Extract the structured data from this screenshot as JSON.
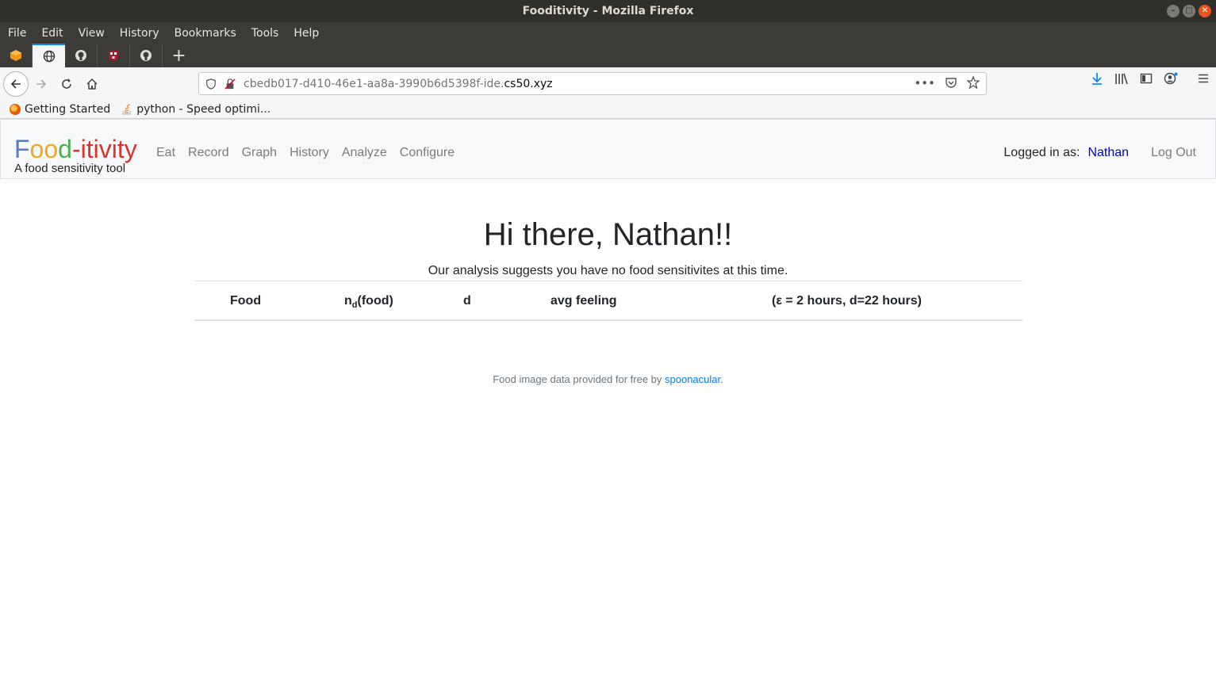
{
  "window": {
    "title": "Fooditivity - Mozilla Firefox"
  },
  "menu": [
    "File",
    "Edit",
    "View",
    "History",
    "Bookmarks",
    "Tools",
    "Help"
  ],
  "tabs": [
    {
      "icon": "box-icon"
    },
    {
      "icon": "globe-icon",
      "active": true
    },
    {
      "icon": "github-icon"
    },
    {
      "icon": "harvard-shield-icon"
    },
    {
      "icon": "github-icon"
    }
  ],
  "url": {
    "path": "cbedb017-d410-46e1-aa8a-3990b6d5398f-ide.",
    "domain": "cs50.xyz"
  },
  "bookmarks": [
    {
      "label": "Getting Started",
      "icon": "firefox-icon"
    },
    {
      "label": "python - Speed optimi...",
      "icon": "stackoverflow-icon"
    }
  ],
  "app": {
    "brand": {
      "p1": "F",
      "p2": "oo",
      "p3": "d",
      "p4": "-itivity"
    },
    "tagline": "A food sensitivity tool",
    "nav": [
      "Eat",
      "Record",
      "Graph",
      "History",
      "Analyze",
      "Configure"
    ],
    "logged_label": "Logged in as:",
    "username": "Nathan",
    "logout": "Log Out"
  },
  "main": {
    "greeting": "Hi there, Nathan!!",
    "analysis": "Our analysis suggests you have no food sensitivites at this time.",
    "table_headers": {
      "food": "Food",
      "nd_n": "n",
      "nd_sub": "d",
      "nd_rest": "(food)",
      "d": "d",
      "avg": "avg feeling",
      "params": "(ε = 2 hours, d=22 hours)"
    }
  },
  "footer": {
    "text": "Food image data provided for free by ",
    "link": "spoonacular",
    "end": "."
  },
  "colors": {
    "brand_blue": "#537bc4",
    "brand_yellow": "#f5a623",
    "brand_green": "#4caf50",
    "brand_red": "#d9342b",
    "link": "#0000cc"
  }
}
